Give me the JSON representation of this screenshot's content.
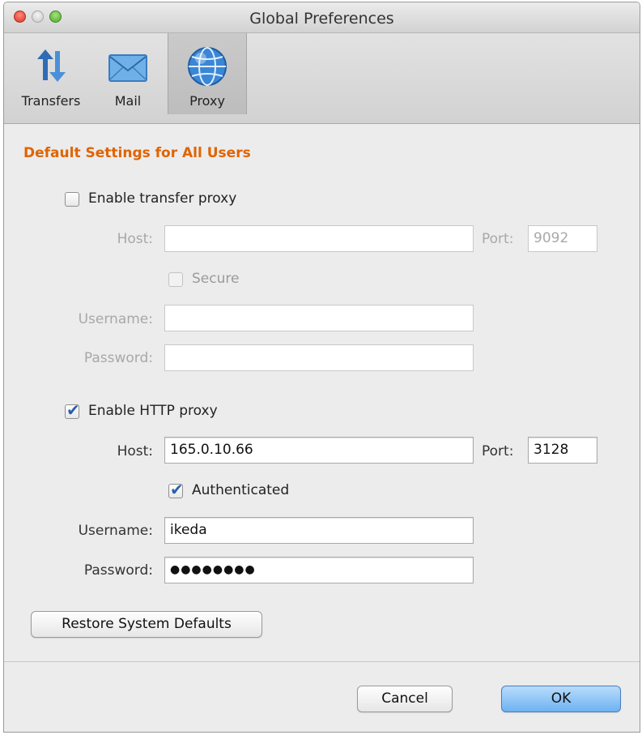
{
  "window": {
    "title": "Global Preferences"
  },
  "toolbar": {
    "items": [
      {
        "label": "Transfers",
        "icon": "transfers-arrows-icon"
      },
      {
        "label": "Mail",
        "icon": "mail-envelope-icon"
      },
      {
        "label": "Proxy",
        "icon": "globe-icon",
        "selected": true
      }
    ]
  },
  "section_title": "Default Settings for All Users",
  "transfer_proxy": {
    "enable_label": "Enable transfer proxy",
    "enabled": false,
    "host_label": "Host:",
    "host_value": "",
    "port_label": "Port:",
    "port_value": "9092",
    "secure_label": "Secure",
    "secure_checked": false,
    "username_label": "Username:",
    "username_value": "",
    "password_label": "Password:",
    "password_value": ""
  },
  "http_proxy": {
    "enable_label": "Enable HTTP proxy",
    "enabled": true,
    "host_label": "Host:",
    "host_value": "165.0.10.66",
    "port_label": "Port:",
    "port_value": "3128",
    "auth_label": "Authenticated",
    "auth_checked": true,
    "username_label": "Username:",
    "username_value": "ikeda",
    "password_label": "Password:",
    "password_value": "●●●●●●●●"
  },
  "buttons": {
    "restore": "Restore System Defaults",
    "cancel": "Cancel",
    "ok": "OK"
  },
  "colors": {
    "section_title": "#e06400",
    "checkbox_check": "#2a5fad",
    "ok_button": "#6eb2f2"
  }
}
